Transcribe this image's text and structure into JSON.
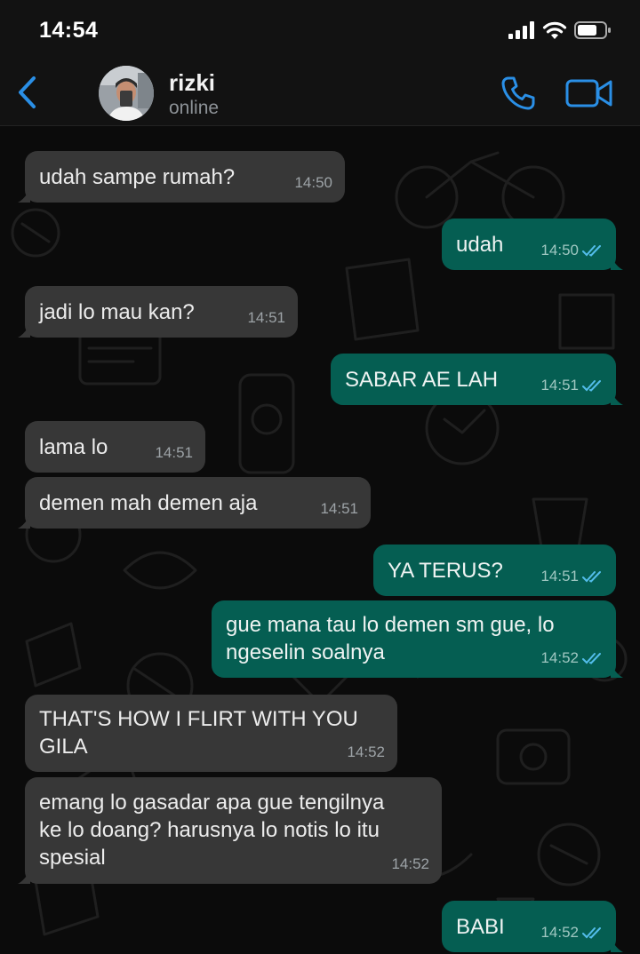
{
  "status_bar": {
    "time": "14:54"
  },
  "header": {
    "back_label": "",
    "contact_name": "rizki",
    "contact_status": "online"
  },
  "colors": {
    "incoming_bubble": "#373737",
    "outgoing_bubble": "#055e52",
    "accent": "#2a8fe6",
    "read_ticks": "#53bdeb"
  },
  "messages": [
    {
      "direction": "in",
      "text": "udah sampe rumah?",
      "time": "14:50"
    },
    {
      "direction": "out",
      "text": "udah",
      "time": "14:50",
      "read": true
    },
    {
      "direction": "in",
      "text": "jadi lo mau kan?",
      "time": "14:51"
    },
    {
      "direction": "out",
      "text": "SABAR AE LAH",
      "time": "14:51",
      "read": true
    },
    {
      "direction": "in",
      "text": "lama lo",
      "time": "14:51"
    },
    {
      "direction": "in",
      "text": "demen mah demen aja",
      "time": "14:51"
    },
    {
      "direction": "out",
      "text": "YA TERUS?",
      "time": "14:51",
      "read": true
    },
    {
      "direction": "out",
      "text": "gue mana tau lo demen sm gue, lo\nngeselin soalnya",
      "time": "14:52",
      "read": true
    },
    {
      "direction": "in",
      "text": "THAT'S HOW I FLIRT WITH YOU\nGILA",
      "time": "14:52"
    },
    {
      "direction": "in",
      "text": "emang lo gasadar apa gue tengilnya\nke lo doang? harusnya lo notis lo itu\nspesial",
      "time": "14:52"
    },
    {
      "direction": "out",
      "text": "BABI",
      "time": "14:52",
      "read": true
    }
  ]
}
